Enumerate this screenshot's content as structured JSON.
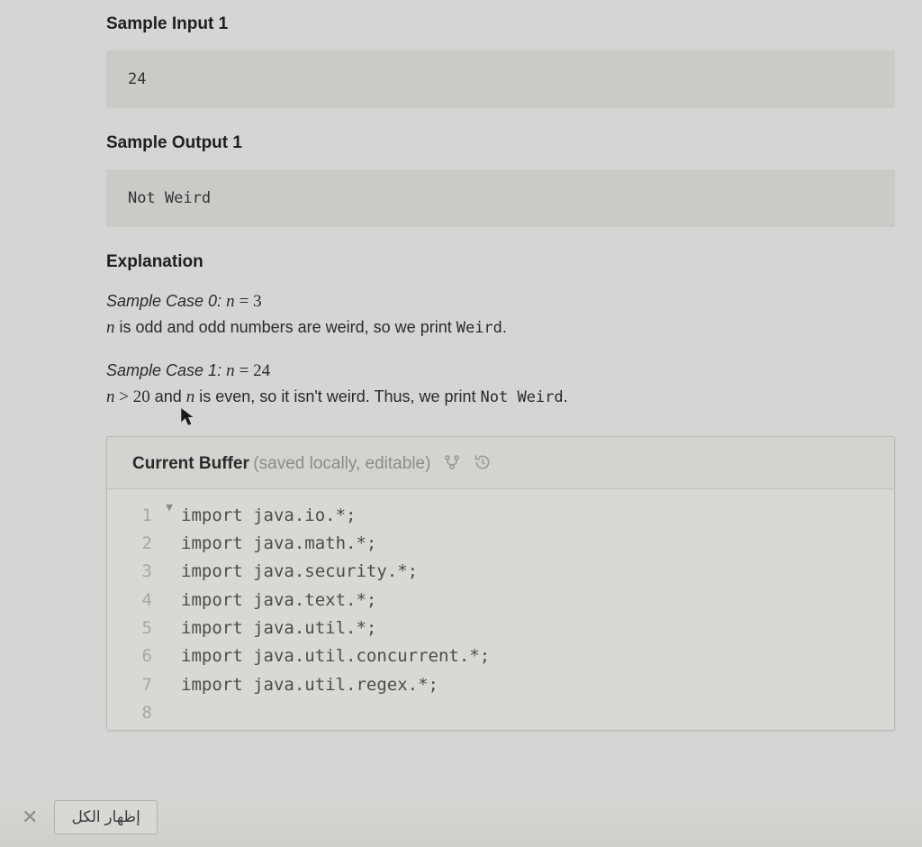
{
  "headings": {
    "sample_input_1": "Sample Input 1",
    "sample_output_1": "Sample Output 1",
    "explanation": "Explanation"
  },
  "sample_input_value": "24",
  "sample_output_value": "Not Weird",
  "explanation": {
    "case0_label": "Sample Case 0:",
    "case0_eq_lhs": "n",
    "case0_eq_rhs": "3",
    "case0_line_pre": " is odd and odd numbers are weird, so we print ",
    "case0_code": "Weird",
    "case0_line_post": ".",
    "case1_label": "Sample Case 1:",
    "case1_eq_lhs": "n",
    "case1_eq_rhs": "24",
    "case1_line2_pre_n": "n",
    "case1_line2_gt": " > ",
    "case1_line2_20": "20",
    "case1_line2_mid": " and ",
    "case1_line2_n2": "n",
    "case1_line2_tail": " is even, so it isn't weird. Thus, we print ",
    "case1_code": "Not Weird",
    "case1_line2_post": "."
  },
  "editor": {
    "title_strong": "Current Buffer",
    "title_sub": "(saved locally, editable)",
    "icons": {
      "branch": "branch-icon",
      "history": "history-icon"
    },
    "lines": [
      "import java.io.*;",
      "import java.math.*;",
      "import java.security.*;",
      "import java.text.*;",
      "import java.util.*;",
      "import java.util.concurrent.*;",
      "import java.util.regex.*;",
      ""
    ]
  },
  "bottom": {
    "show_all": "إظهار الكل"
  }
}
